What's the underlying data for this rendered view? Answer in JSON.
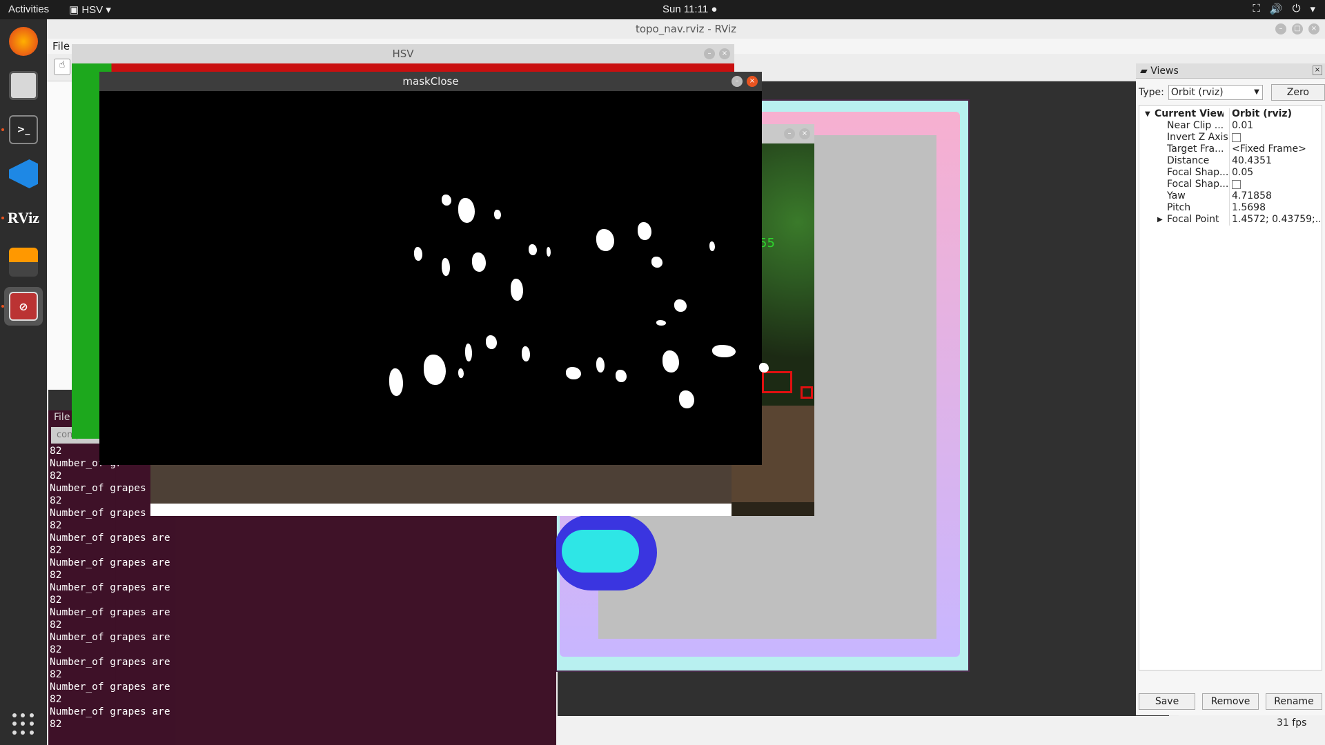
{
  "topbar": {
    "activities": "Activities",
    "app_menu": "HSV",
    "clock": "Sun 11:11 ●"
  },
  "dock": {
    "items": [
      "firefox-icon",
      "files-icon",
      "terminal-icon",
      "vscode-icon",
      "rviz-icon",
      "sublime-icon",
      "app-icon"
    ],
    "rviz_label": "RViz"
  },
  "rviz": {
    "title": "topo_nav.rviz - RViz",
    "menu_file": "File",
    "views": {
      "header": "Views",
      "type_label": "Type:",
      "type_value": "Orbit (rviz)",
      "zero_button": "Zero",
      "props": [
        {
          "key": "Current View",
          "value": "Orbit (rviz)",
          "top": true
        },
        {
          "key": "Near Clip ...",
          "value": "0.01"
        },
        {
          "key": "Invert Z Axis",
          "value": "",
          "check": true
        },
        {
          "key": "Target Fra...",
          "value": "<Fixed Frame>"
        },
        {
          "key": "Distance",
          "value": "40.4351"
        },
        {
          "key": "Focal Shap...",
          "value": "0.05"
        },
        {
          "key": "Focal Shap...",
          "value": "",
          "check": true
        },
        {
          "key": "Yaw",
          "value": "4.71858"
        },
        {
          "key": "Pitch",
          "value": "1.5698"
        },
        {
          "key": "Focal Point",
          "value": "1.4572; 0.43759;...",
          "expand": true
        }
      ],
      "save": "Save",
      "remove": "Remove",
      "rename": "Rename"
    },
    "fps": "31 fps"
  },
  "terminal": {
    "menu_file": "File",
    "tab_label": "computi",
    "lines": [
      "82",
      "Number_of gr",
      "82",
      "Number_of grapes",
      "82",
      "Number_of grapes are",
      "82",
      "Number_of grapes are",
      "82",
      "Number_of grapes are",
      "82",
      "Number_of grapes are",
      "82",
      "Number_of grapes are",
      "82",
      "Number_of grapes are",
      "82",
      "Number_of grapes are",
      "82",
      "Number_of grapes are",
      "82",
      "Number_of grapes are",
      "82"
    ]
  },
  "hsv_window": {
    "title": "HSV"
  },
  "camera_window": {
    "overlay_number": "55"
  },
  "mask_window": {
    "title": "maskClose"
  }
}
